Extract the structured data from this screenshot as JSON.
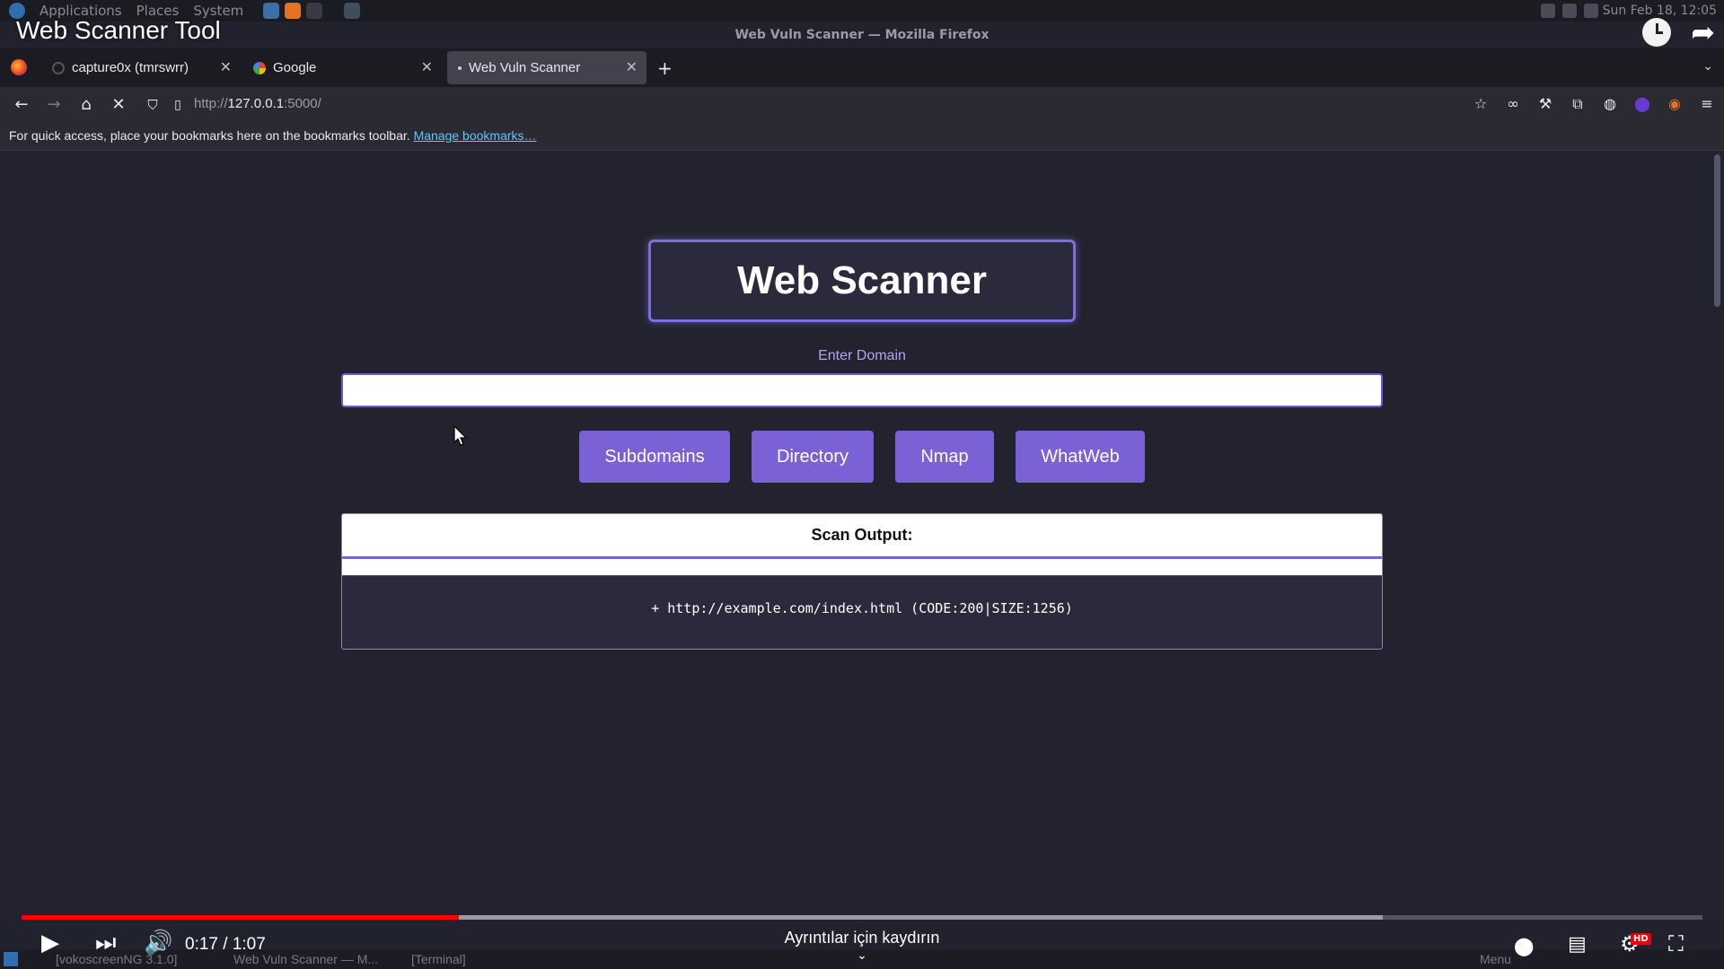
{
  "os_panel": {
    "menus": [
      "Applications",
      "Places",
      "System"
    ],
    "clock": "Sun Feb 18, 12:05"
  },
  "video": {
    "title": "Web Scanner Tool",
    "time": "0:17 / 1:07",
    "scroll_hint": "Ayrıntılar için kaydırın",
    "hd_badge": "HD",
    "progress_played": 0.26,
    "progress_buffered": 0.81
  },
  "browser": {
    "window_title": "Web Vuln Scanner — Mozilla Firefox",
    "tabs": [
      {
        "label": "capture0x (tmrswrr)",
        "active": false
      },
      {
        "label": "Google",
        "active": false
      },
      {
        "label": "Web Vuln Scanner",
        "active": true
      }
    ],
    "url_prefix": "http://",
    "url_host": "127.0.0.1",
    "url_rest": ":5000/",
    "bookmarks_text": "For quick access, place your bookmarks here on the bookmarks toolbar.",
    "bookmarks_link": "Manage bookmarks…"
  },
  "app": {
    "heading": "Web Scanner",
    "domain_label": "Enter Domain",
    "domain_value": "",
    "buttons": {
      "subdomains": "Subdomains",
      "directory": "Directory",
      "nmap": "Nmap",
      "whatweb": "WhatWeb"
    },
    "output_title": "Scan Output:",
    "output_line": "+ http://example.com/index.html (CODE:200|SIZE:1256)"
  },
  "taskbar": {
    "items": [
      "[vokoscreenNG 3.1.0]",
      "Web Vuln Scanner — M...",
      "[Terminal]"
    ],
    "menu": "Menu"
  },
  "colors": {
    "accent": "#7a62d6",
    "page_bg": "#23232f",
    "progress_played": "#ff0000"
  }
}
